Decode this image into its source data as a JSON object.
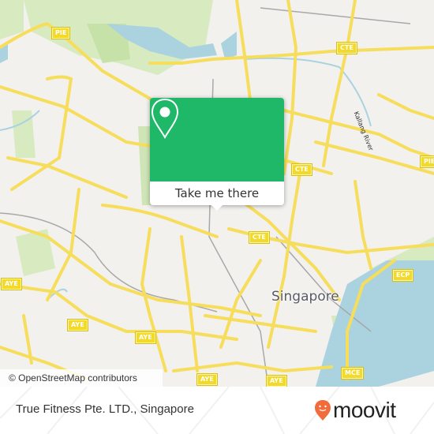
{
  "map": {
    "city_label": "Singapore",
    "river_label": "Kallang River",
    "road_shields": [
      {
        "label": "PIE"
      },
      {
        "label": "CTE"
      },
      {
        "label": "CTE"
      },
      {
        "label": "CTE"
      },
      {
        "label": "PIE"
      },
      {
        "label": "ECP"
      },
      {
        "label": "AYE"
      },
      {
        "label": "AYE"
      },
      {
        "label": "AYE"
      },
      {
        "label": "AYE"
      },
      {
        "label": "AYE"
      },
      {
        "label": "MCE"
      }
    ],
    "attribution": "© OpenStreetMap contributors",
    "colors": {
      "land": "#f2f1ee",
      "water": "#aad3df",
      "park": "#d7eac0",
      "road": "#f7dd5c"
    }
  },
  "popup": {
    "icon": "location-pin-icon",
    "button_label": "Take me there",
    "color": "#1fb868"
  },
  "footer": {
    "place_title": "True Fitness Pte. LTD., Singapore",
    "brand": "moovit",
    "brand_color": "#f26b3a"
  }
}
